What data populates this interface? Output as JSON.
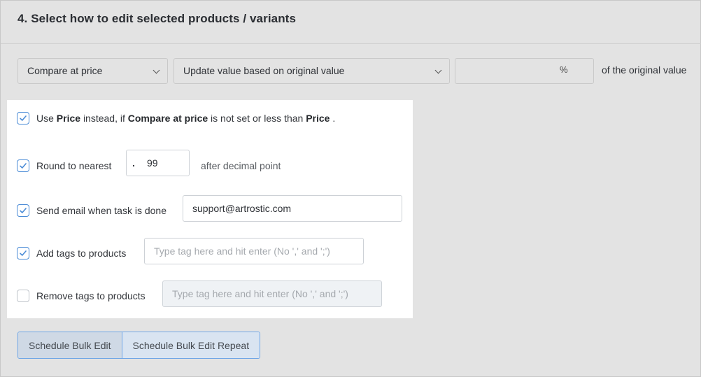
{
  "section": {
    "title": "4. Select how to edit selected products / variants"
  },
  "controls": {
    "field_select": "Compare at price",
    "mode_select": "Update value based on original value",
    "value_input": "",
    "value_unit": "%",
    "suffix": "of the original value"
  },
  "options": {
    "use_price": {
      "checked": true,
      "prefix": "Use",
      "price_word": "Price",
      "middle": "instead, if",
      "compare_word": "Compare at price",
      "tail": "is not set or less than",
      "price_word2": "Price",
      "end": "."
    },
    "round": {
      "checked": true,
      "label": "Round to nearest",
      "decimal_mark": ".",
      "value": "99",
      "after": "after decimal point"
    },
    "email": {
      "checked": true,
      "label": "Send email when task is done",
      "value": "support@artrostic.com"
    },
    "add_tags": {
      "checked": true,
      "label": "Add tags to products",
      "placeholder": "Type tag here and hit enter (No ',' and ';')"
    },
    "remove_tags": {
      "checked": false,
      "label": "Remove tags to products",
      "placeholder": "Type tag here and hit enter (No ',' and ';')"
    }
  },
  "actions": {
    "schedule": "Schedule Bulk Edit",
    "schedule_repeat": "Schedule Bulk Edit Repeat"
  },
  "colors": {
    "accent": "#4a8bd6",
    "background": "#e3e3e3",
    "panel": "#ffffff"
  }
}
